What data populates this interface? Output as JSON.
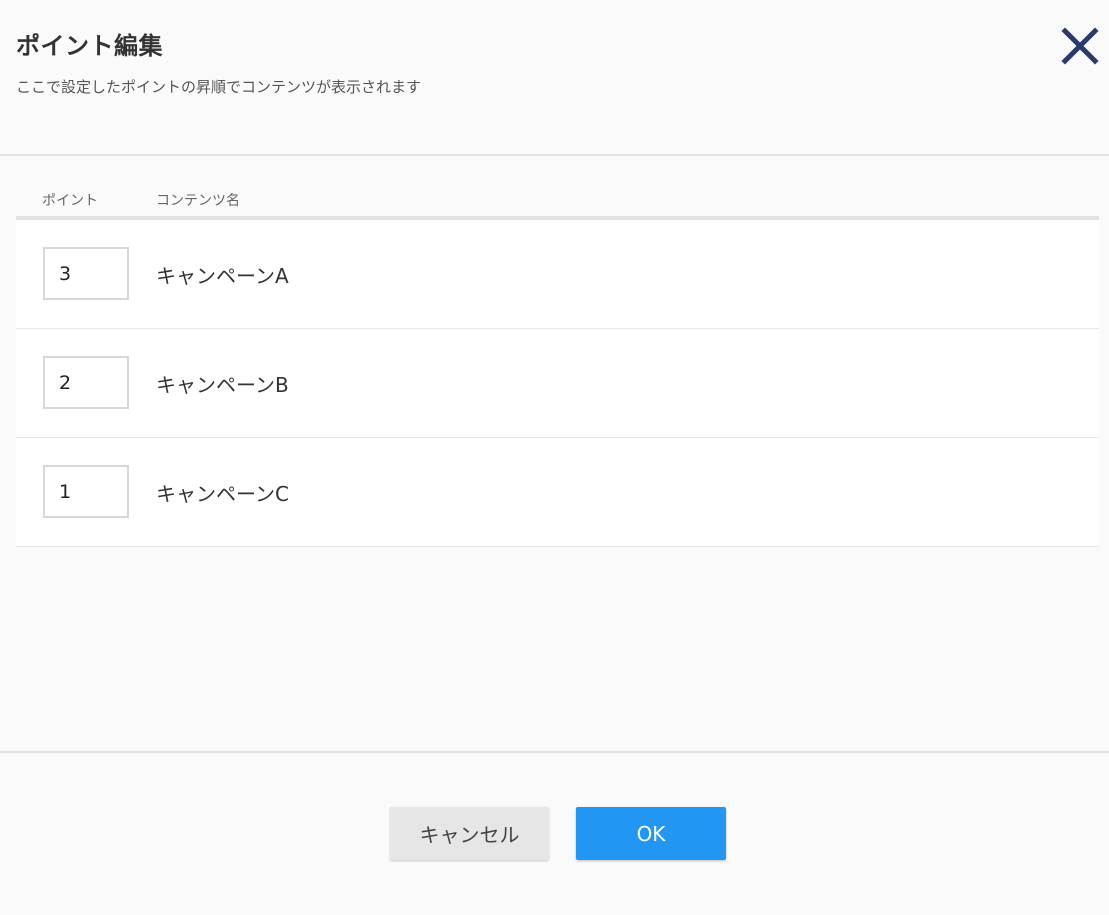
{
  "dialog": {
    "title": "ポイント編集",
    "subtitle": "ここで設定したポイントの昇順でコンテンツが表示されます",
    "close_icon": "close-icon"
  },
  "table": {
    "columns": {
      "point": "ポイント",
      "name": "コンテンツ名"
    },
    "rows": [
      {
        "point": "3",
        "name": "キャンペーンA"
      },
      {
        "point": "2",
        "name": "キャンペーンB"
      },
      {
        "point": "1",
        "name": "キャンペーンC"
      }
    ]
  },
  "footer": {
    "cancel_label": "キャンセル",
    "ok_label": "OK"
  },
  "colors": {
    "accent": "#2196f3",
    "close_icon": "#2b3a6b",
    "background": "#fafafa"
  }
}
